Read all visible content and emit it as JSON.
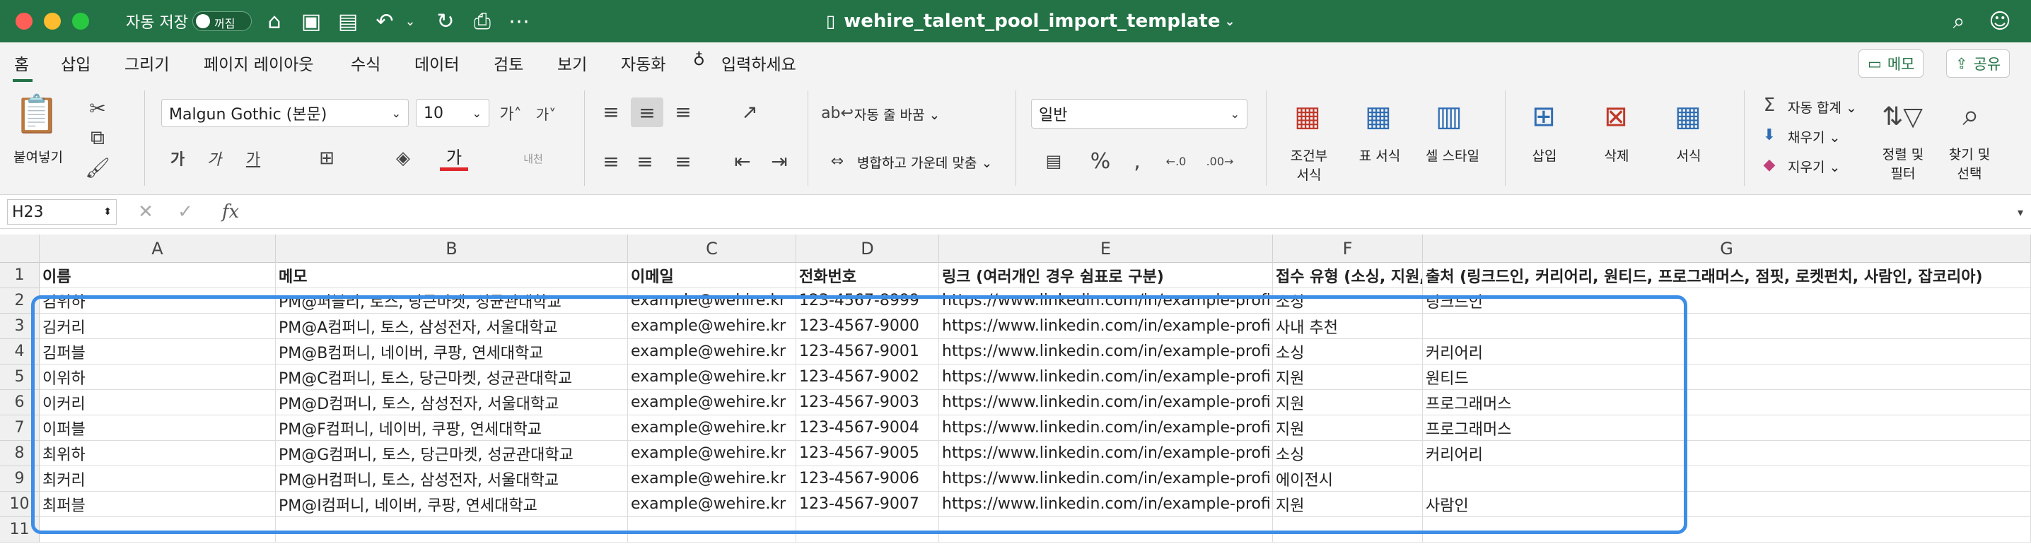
{
  "window": {
    "autosave_label": "자동 저장",
    "autosave_state": "꺼짐",
    "doc_title": "wehire_talent_pool_import_template"
  },
  "menu": {
    "tabs": [
      "홈",
      "삽입",
      "그리기",
      "페이지 레이아웃",
      "수식",
      "데이터",
      "검토",
      "보기",
      "자동화"
    ],
    "tell_me": "입력하세요",
    "memo": "메모",
    "share": "공유"
  },
  "ribbon": {
    "paste": "붙여넣기",
    "font_name": "Malgun Gothic (본문)",
    "font_size": "10",
    "wrap_text": "자동 줄 바꿈",
    "merge_center": "병합하고 가운데 맞춤",
    "number_format": "일반",
    "conditional_format": [
      "조건부",
      "서식"
    ],
    "format_table": "표 서식",
    "cell_style": "셀 스타일",
    "insert": "삽입",
    "delete": "삭제",
    "format": "서식",
    "autosum": "자동 합계",
    "fill": "채우기",
    "clear": "지우기",
    "sort_filter": [
      "정렬 및",
      "필터"
    ],
    "find_select": [
      "찾기 및",
      "선택"
    ]
  },
  "formula_bar": {
    "name_box": "H23",
    "fx": "fx",
    "formula": ""
  },
  "sheet": {
    "columns": [
      "A",
      "B",
      "C",
      "D",
      "E",
      "F",
      "G"
    ],
    "row_numbers": [
      "1",
      "2",
      "3",
      "4",
      "5",
      "6",
      "7",
      "8",
      "9",
      "10",
      "11"
    ],
    "header": [
      "이름",
      "메모",
      "이메일",
      "전화번호",
      "링크 (여러개인 경우 쉼표로 구분)",
      "접수 유형 (소싱, 지원, 사내 추천, 에이전시)",
      "출처 (링크드인, 커리어리, 원티드, 프로그래머스, 점핏, 로켓펀치, 사람인, 잡코리아)"
    ],
    "rows": [
      [
        "김위하",
        "PM@퍼블리, 토스, 당근마켓, 성균관대학교",
        "example@wehire.kr",
        "123-4567-8999",
        "https://www.linkedin.com/in/example-profile",
        "소싱",
        "링크드인"
      ],
      [
        "김커리",
        "PM@A컴퍼니, 토스, 삼성전자, 서울대학교",
        "example@wehire.kr",
        "123-4567-9000",
        "https://www.linkedin.com/in/example-profile",
        "사내 추천",
        ""
      ],
      [
        "김퍼블",
        "PM@B컴퍼니, 네이버, 쿠팡, 연세대학교",
        "example@wehire.kr",
        "123-4567-9001",
        "https://www.linkedin.com/in/example-profile",
        "소싱",
        "커리어리"
      ],
      [
        "이위하",
        "PM@C컴퍼니, 토스, 당근마켓, 성균관대학교",
        "example@wehire.kr",
        "123-4567-9002",
        "https://www.linkedin.com/in/example-profile",
        "지원",
        "원티드"
      ],
      [
        "이커리",
        "PM@D컴퍼니, 토스, 삼성전자, 서울대학교",
        "example@wehire.kr",
        "123-4567-9003",
        "https://www.linkedin.com/in/example-profile",
        "지원",
        "프로그래머스"
      ],
      [
        "이퍼블",
        "PM@F컴퍼니, 네이버, 쿠팡, 연세대학교",
        "example@wehire.kr",
        "123-4567-9004",
        "https://www.linkedin.com/in/example-profile",
        "지원",
        "프로그래머스"
      ],
      [
        "최위하",
        "PM@G컴퍼니, 토스, 당근마켓, 성균관대학교",
        "example@wehire.kr",
        "123-4567-9005",
        "https://www.linkedin.com/in/example-profile",
        "소싱",
        "커리어리"
      ],
      [
        "최커리",
        "PM@H컴퍼니, 토스, 삼성전자, 서울대학교",
        "example@wehire.kr",
        "123-4567-9006",
        "https://www.linkedin.com/in/example-profile",
        "에이전시",
        ""
      ],
      [
        "최퍼블",
        "PM@I컴퍼니, 네이버, 쿠팡, 연세대학교",
        "example@wehire.kr",
        "123-4567-9007",
        "https://www.linkedin.com/in/example-profile",
        "지원",
        "사람인"
      ]
    ]
  },
  "colors": {
    "titlebar": "#237346",
    "highlight": "#3d8ee6"
  }
}
